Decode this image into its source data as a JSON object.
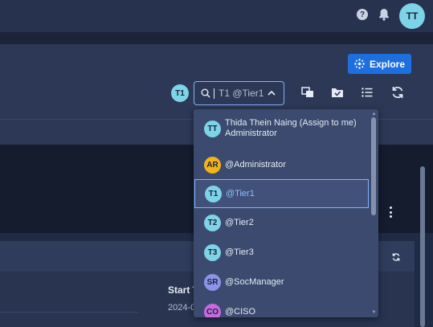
{
  "header": {
    "help_icon": "help-circle-icon",
    "bell_icon": "bell-icon",
    "user_initials": "TT"
  },
  "toolbar": {
    "explore_label": "Explore",
    "assignee_badge": "T1",
    "search_value": "T1 @Tier1"
  },
  "dropdown": {
    "items": [
      {
        "initials": "TT",
        "label": "Thida Thein Naing (Assign to me)",
        "sublabel": "Administrator",
        "color": "#7dd3e8"
      },
      {
        "initials": "AR",
        "label": "@Administrator",
        "sublabel": "",
        "color": "#f2b418"
      },
      {
        "initials": "T1",
        "label": "@Tier1",
        "sublabel": "",
        "color": "#7dd3e8",
        "selected": true
      },
      {
        "initials": "T2",
        "label": "@Tier2",
        "sublabel": "",
        "color": "#7dd3e8"
      },
      {
        "initials": "T3",
        "label": "@Tier3",
        "sublabel": "",
        "color": "#7dd3e8"
      },
      {
        "initials": "SR",
        "label": "@SocManager",
        "sublabel": "",
        "color": "#8b94e8"
      },
      {
        "initials": "CO",
        "label": "@CISO",
        "sublabel": "",
        "color": "#c46be0"
      }
    ]
  },
  "card": {
    "start_label": "Start T",
    "date_value": "2024-0"
  },
  "colors": {
    "accent": "#1d6fe0",
    "selected_border": "#7fb3ff"
  }
}
